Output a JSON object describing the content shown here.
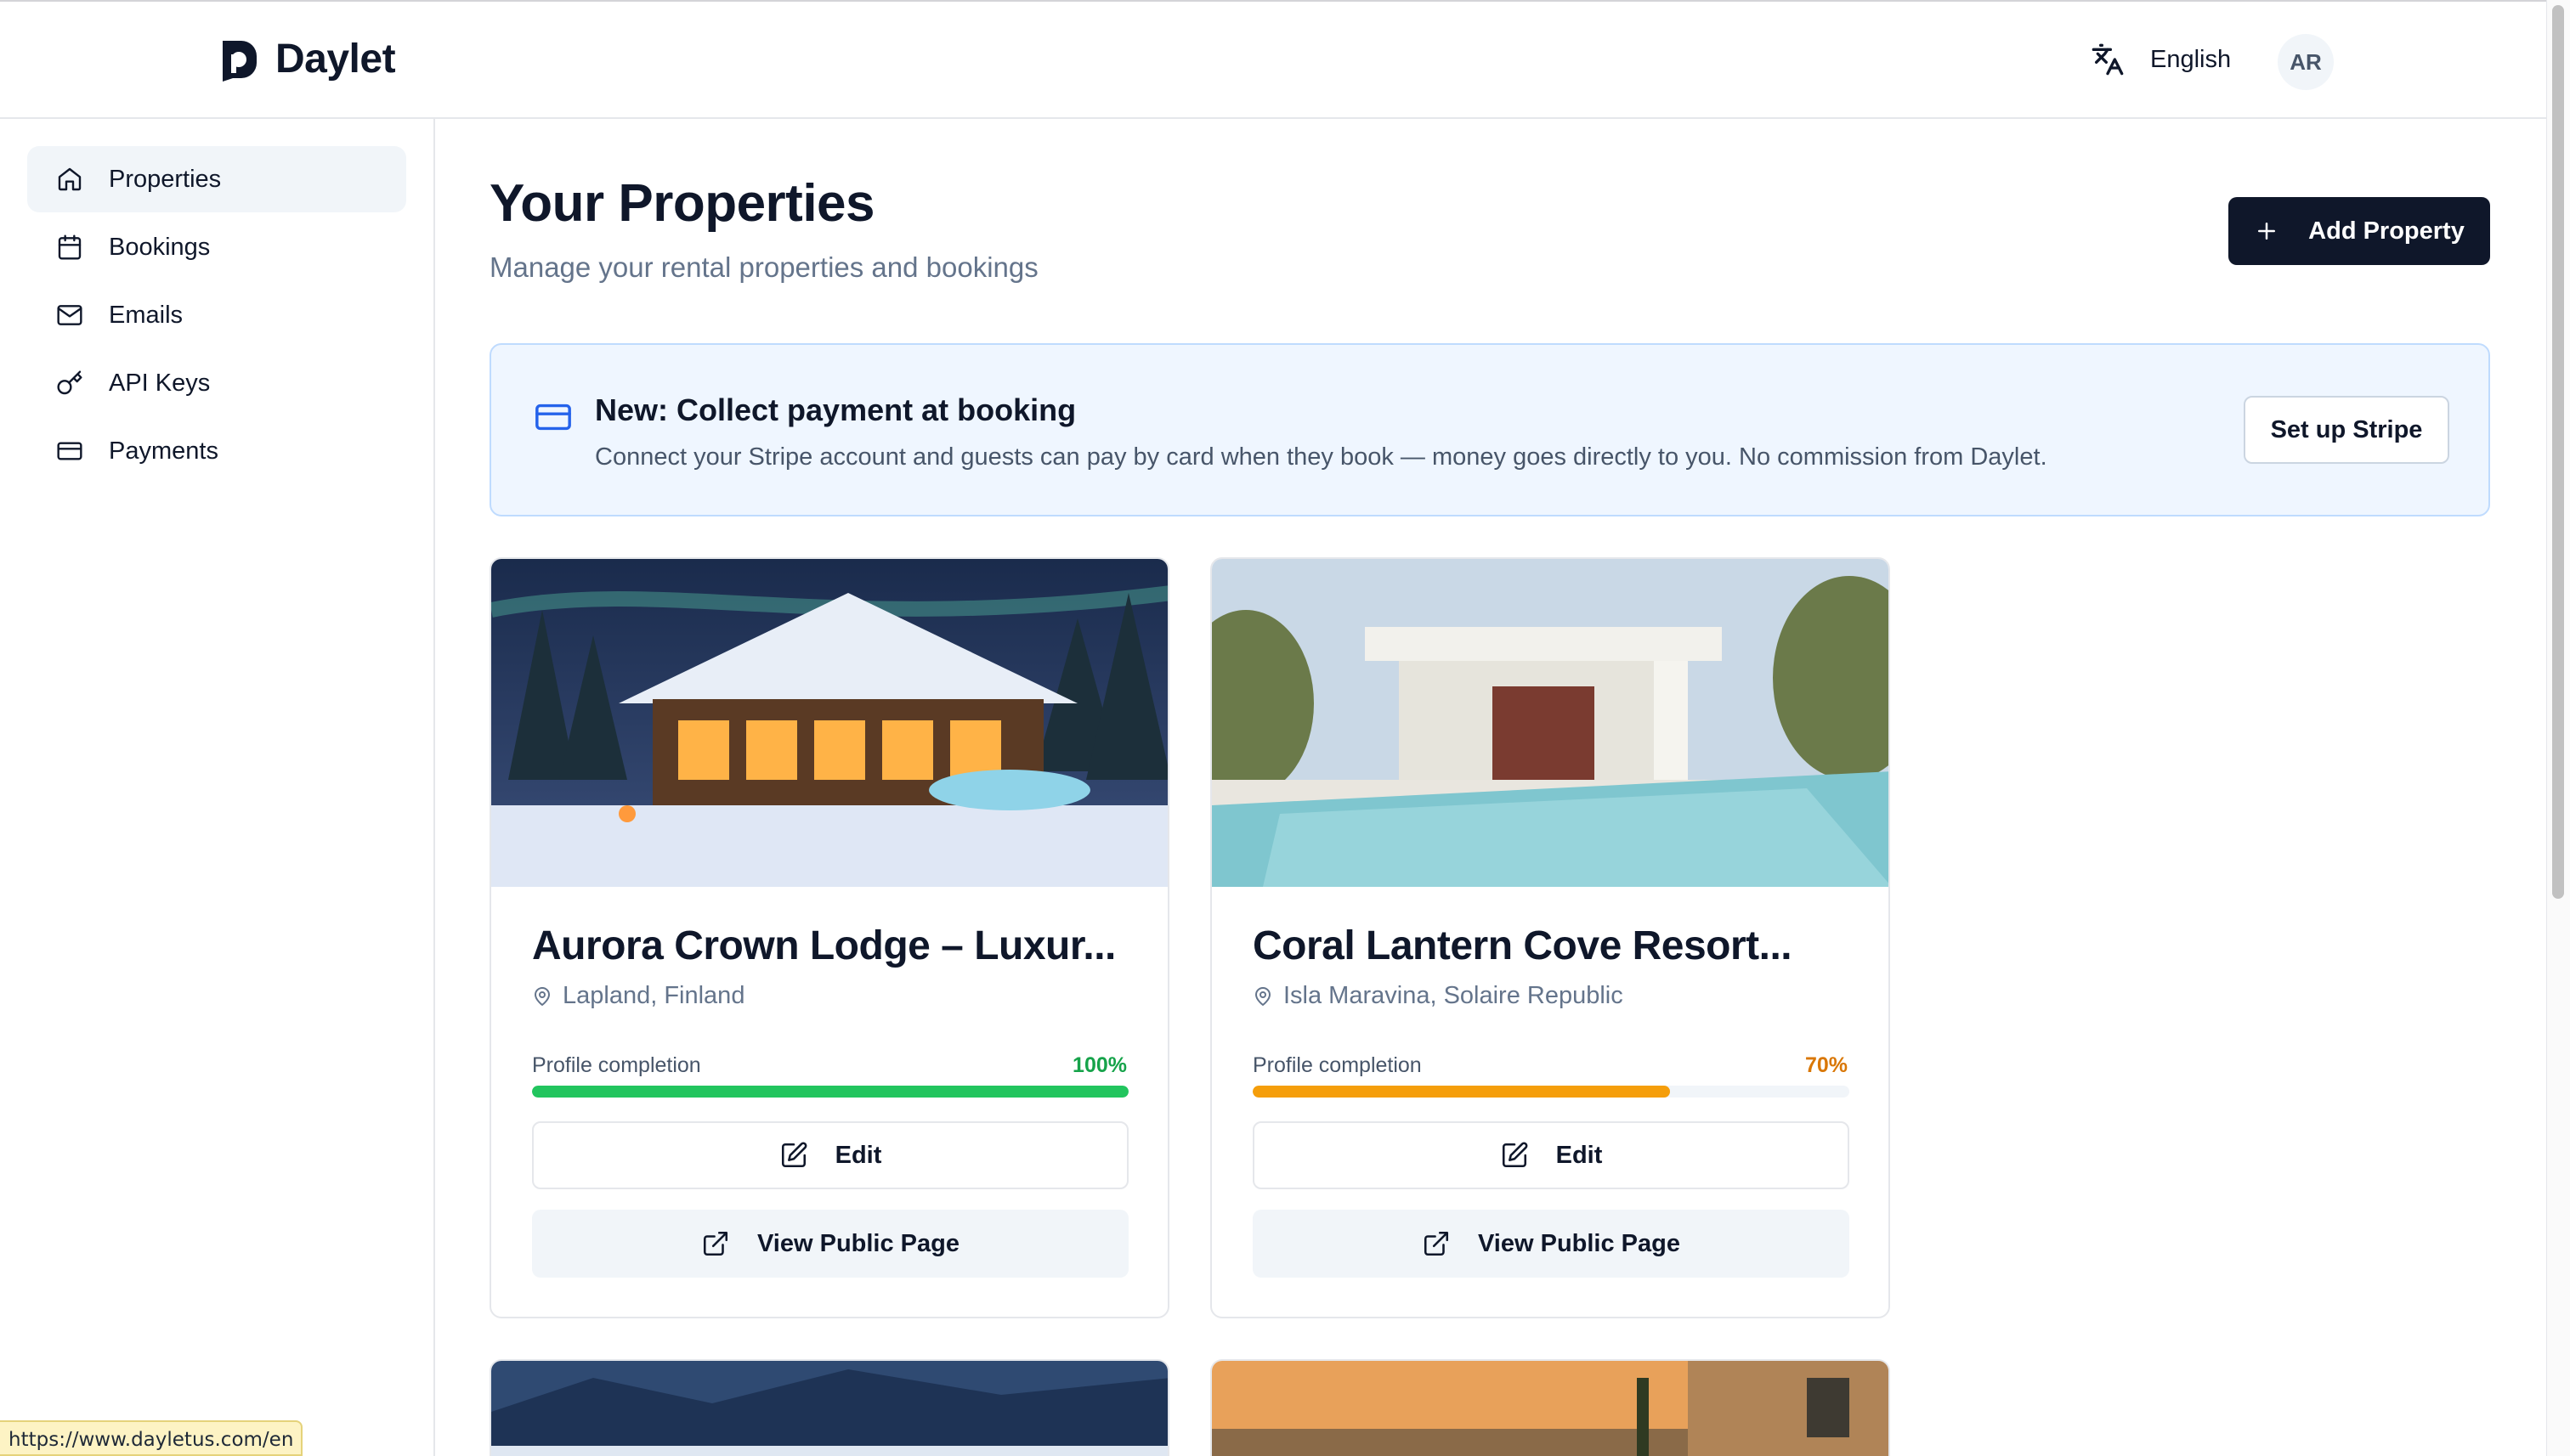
{
  "header": {
    "brand": "Daylet",
    "language": "English",
    "avatar_initials": "AR"
  },
  "sidebar": {
    "items": [
      {
        "label": "Properties",
        "icon": "home-icon",
        "active": true
      },
      {
        "label": "Bookings",
        "icon": "calendar-icon",
        "active": false
      },
      {
        "label": "Emails",
        "icon": "mail-icon",
        "active": false
      },
      {
        "label": "API Keys",
        "icon": "key-icon",
        "active": false
      },
      {
        "label": "Payments",
        "icon": "credit-card-icon",
        "active": false
      }
    ]
  },
  "main": {
    "title": "Your Properties",
    "subtitle": "Manage your rental properties and bookings",
    "add_button": "Add Property"
  },
  "banner": {
    "title": "New: Collect payment at booking",
    "text": "Connect your Stripe account and guests can pay by card when they book — money goes directly to you. No commission from Daylet.",
    "button": "Set up Stripe"
  },
  "properties": [
    {
      "title": "Aurora Crown Lodge – Luxur...",
      "location": "Lapland, Finland",
      "completion_label": "Profile completion",
      "completion_text": "100%",
      "completion": 1.0,
      "completion_color": "#22c55e",
      "edit_label": "Edit",
      "view_label": "View Public Page"
    },
    {
      "title": "Coral Lantern Cove Resort...",
      "location": "Isla Maravina, Solaire Republic",
      "completion_label": "Profile completion",
      "completion_text": "70%",
      "completion": 0.7,
      "completion_color": "#f59e0b",
      "edit_label": "Edit",
      "view_label": "View Public Page"
    }
  ],
  "status_bar": {
    "url": "https://www.dayletus.com/en"
  },
  "colors": {
    "primary": "#0f172a",
    "banner_bg": "#eff6ff",
    "accent_blue": "#2563eb"
  }
}
